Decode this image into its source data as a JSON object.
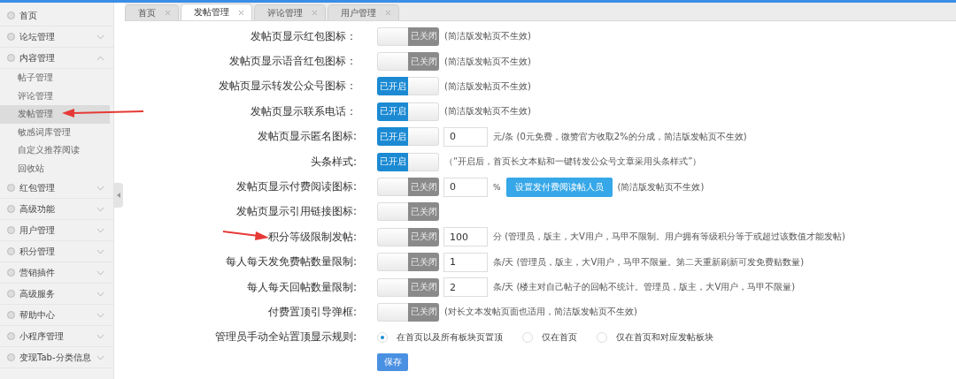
{
  "sidebar": {
    "items": [
      {
        "label": "首页"
      },
      {
        "label": "论坛管理",
        "expanded": false
      },
      {
        "label": "内容管理",
        "expanded": true,
        "children": [
          {
            "label": "帖子管理",
            "selected": false
          },
          {
            "label": "评论管理",
            "selected": false
          },
          {
            "label": "发帖管理",
            "selected": true
          },
          {
            "label": "敏感词库管理",
            "selected": false
          },
          {
            "label": "自定义推荐阅读",
            "selected": false
          },
          {
            "label": "回收站",
            "selected": false
          }
        ]
      },
      {
        "label": "红包管理",
        "expanded": false
      },
      {
        "label": "高级功能",
        "expanded": false
      },
      {
        "label": "用户管理",
        "expanded": false
      },
      {
        "label": "积分管理",
        "expanded": false
      },
      {
        "label": "营销插件",
        "expanded": false
      },
      {
        "label": "高级服务",
        "expanded": false
      },
      {
        "label": "帮助中心",
        "expanded": false
      },
      {
        "label": "小程序管理",
        "expanded": false
      },
      {
        "label": "变现Tab-分类信息",
        "expanded": false
      }
    ]
  },
  "tabs": [
    {
      "label": "首页",
      "selected": false
    },
    {
      "label": "发帖管理",
      "selected": true
    },
    {
      "label": "评论管理",
      "selected": false
    },
    {
      "label": "用户管理",
      "selected": false
    }
  ],
  "form": {
    "rows": [
      {
        "kind": "toggle",
        "label": "发帖页显示红包图标：",
        "toggle": {
          "on": false,
          "text": "已关闭"
        },
        "note": "(简洁版发帖页不生效)"
      },
      {
        "kind": "toggle",
        "label": "发帖页显示语音红包图标：",
        "toggle": {
          "on": false,
          "text": "已关闭"
        },
        "note": "(简洁版发帖页不生效)"
      },
      {
        "kind": "toggle",
        "label": "发帖页显示转发公众号图标：",
        "toggle": {
          "on": true,
          "text": "已开启"
        },
        "note": "(简洁版发帖页不生效)"
      },
      {
        "kind": "toggle",
        "label": "发帖页显示联系电话：",
        "toggle": {
          "on": true,
          "text": "已开启"
        },
        "note": "(简洁版发帖页不生效)"
      },
      {
        "kind": "toggle",
        "label": "发帖页显示匿名图标:",
        "toggle": {
          "on": true,
          "text": "已开启"
        },
        "value": "0",
        "note": "元/条 (0元免费，微赞官方收取2%的分成，简洁版发帖页不生效)"
      },
      {
        "kind": "toggle",
        "label": "头条样式:",
        "toggle": {
          "on": true,
          "text": "已开启"
        },
        "note": "（“开启后，首页长文本贴和一键转发公众号文章采用头条样式”）"
      },
      {
        "kind": "toggle",
        "label": "发帖页显示付费阅读图标:",
        "toggle": {
          "on": false,
          "text": "已关闭"
        },
        "value": "0",
        "unit": "%",
        "button": "设置发付费阅读帖人员",
        "note": "(简洁版发帖页不生效)"
      },
      {
        "kind": "toggle",
        "label": "发帖页显示引用链接图标:",
        "toggle": {
          "on": false,
          "text": "已关闭"
        }
      },
      {
        "kind": "toggle",
        "label": "积分等级限制发帖:",
        "toggle": {
          "on": false,
          "text": "已关闭"
        },
        "value": "100",
        "note": "分 (管理员，版主，大V用户，马甲不限制。用户拥有等级积分等于或超过该数值才能发帖)"
      },
      {
        "kind": "toggle",
        "label": "每人每天发免费帖数量限制:",
        "toggle": {
          "on": false,
          "text": "已关闭"
        },
        "value": "1",
        "note": "条/天 (管理员，版主，大V用户，马甲不限量。第二天重新刷新可发免费贴数量)"
      },
      {
        "kind": "toggle",
        "label": "每人每天回帖数量限制:",
        "toggle": {
          "on": false,
          "text": "已关闭"
        },
        "value": "2",
        "note": "条/天 (楼主对自己帖子的回帖不统计。管理员，版主，大V用户，马甲不限量)"
      },
      {
        "kind": "toggle",
        "label": "付费置顶引导弹框:",
        "toggle": {
          "on": false,
          "text": "已关闭"
        },
        "note": "(对长文本发帖页面也适用，简洁版发帖页不生效)"
      },
      {
        "kind": "radio",
        "label": "管理员手动全站置顶显示规则:",
        "options": [
          {
            "label": "在首页以及所有板块页置顶",
            "selected": true
          },
          {
            "label": "仅在首页",
            "selected": false
          },
          {
            "label": "仅在首页和对应发帖板块",
            "selected": false
          }
        ]
      }
    ],
    "save_button": "保存"
  }
}
